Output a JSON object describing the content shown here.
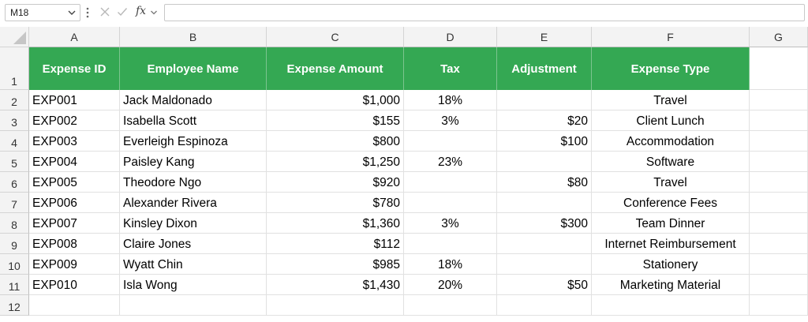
{
  "formula_bar": {
    "name_box": "M18",
    "fx_label": "fx",
    "formula": ""
  },
  "columns": [
    "A",
    "B",
    "C",
    "D",
    "E",
    "F",
    "G"
  ],
  "rows": [
    "1",
    "2",
    "3",
    "4",
    "5",
    "6",
    "7",
    "8",
    "9",
    "10",
    "11",
    "12"
  ],
  "table": {
    "headers": [
      "Expense ID",
      "Employee Name",
      "Expense Amount",
      "Tax",
      "Adjustment",
      "Expense Type"
    ],
    "header_color": "#34a853",
    "rows": [
      [
        "EXP001",
        "Jack Maldonado",
        "$1,000",
        "18%",
        "",
        "Travel"
      ],
      [
        "EXP002",
        "Isabella Scott",
        "$155",
        "3%",
        "$20",
        "Client Lunch"
      ],
      [
        "EXP003",
        "Everleigh Espinoza",
        "$800",
        "",
        "$100",
        "Accommodation"
      ],
      [
        "EXP004",
        "Paisley Kang",
        "$1,250",
        "23%",
        "",
        "Software"
      ],
      [
        "EXP005",
        "Theodore Ngo",
        "$920",
        "",
        "$80",
        "Travel"
      ],
      [
        "EXP006",
        "Alexander Rivera",
        "$780",
        "",
        "",
        "Conference Fees"
      ],
      [
        "EXP007",
        "Kinsley Dixon",
        "$1,360",
        "3%",
        "$300",
        "Team Dinner"
      ],
      [
        "EXP008",
        "Claire Jones",
        "$112",
        "",
        "",
        "Internet Reimbursement"
      ],
      [
        "EXP009",
        "Wyatt Chin",
        "$985",
        "18%",
        "",
        "Stationery"
      ],
      [
        "EXP010",
        "Isla Wong",
        "$1,430",
        "20%",
        "$50",
        "Marketing Material"
      ]
    ]
  },
  "icons": {
    "name_box_dropdown": "chevron-down-icon",
    "more": "vertical-dots-icon",
    "cancel": "cancel-x-icon",
    "enter": "checkmark-icon",
    "function": "fx-icon"
  }
}
